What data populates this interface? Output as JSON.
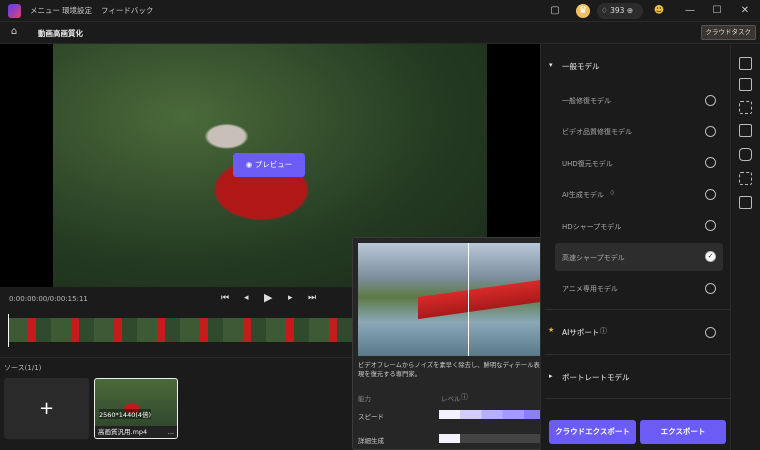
{
  "titlebar": {
    "menu": [
      "メニュー",
      "環境設定",
      "フィードバック"
    ],
    "credits": "393"
  },
  "subbar": {
    "title": "動画高画質化",
    "cloud_task": "クラウドタスク"
  },
  "player": {
    "preview": "プレビュー",
    "time": "0:00:00:00/0:00:15:11"
  },
  "source": {
    "label": "ソース(1/1)",
    "add": "+",
    "thumb_res": "2560*1440(4倍)",
    "thumb_name": "高画質汎用.mp4",
    "more": "..."
  },
  "popup": {
    "desc": "ビデオフレームからノイズを素早く除去し、鮮明なディテール表現を復元する専門家。",
    "ability": "能力",
    "level": "レベル",
    "speed": "スピード",
    "detail": "詳細生成",
    "speed_level": 1.0,
    "detail_level": 0.2
  },
  "panel": {
    "section_general": "一般モデル",
    "models": [
      "一般修復モデル",
      "ビデオ品質修復モデル",
      "UHD復元モデル",
      "AI生成モデル",
      "HDシャープモデル",
      "高速シャープモデル",
      "アニメ専用モデル"
    ],
    "selected_index": 5,
    "ai_support": "AIサポート",
    "portrait": "ポートレートモデル",
    "cloud_export": "クラウドエクスポート",
    "export": "エクスポート"
  }
}
